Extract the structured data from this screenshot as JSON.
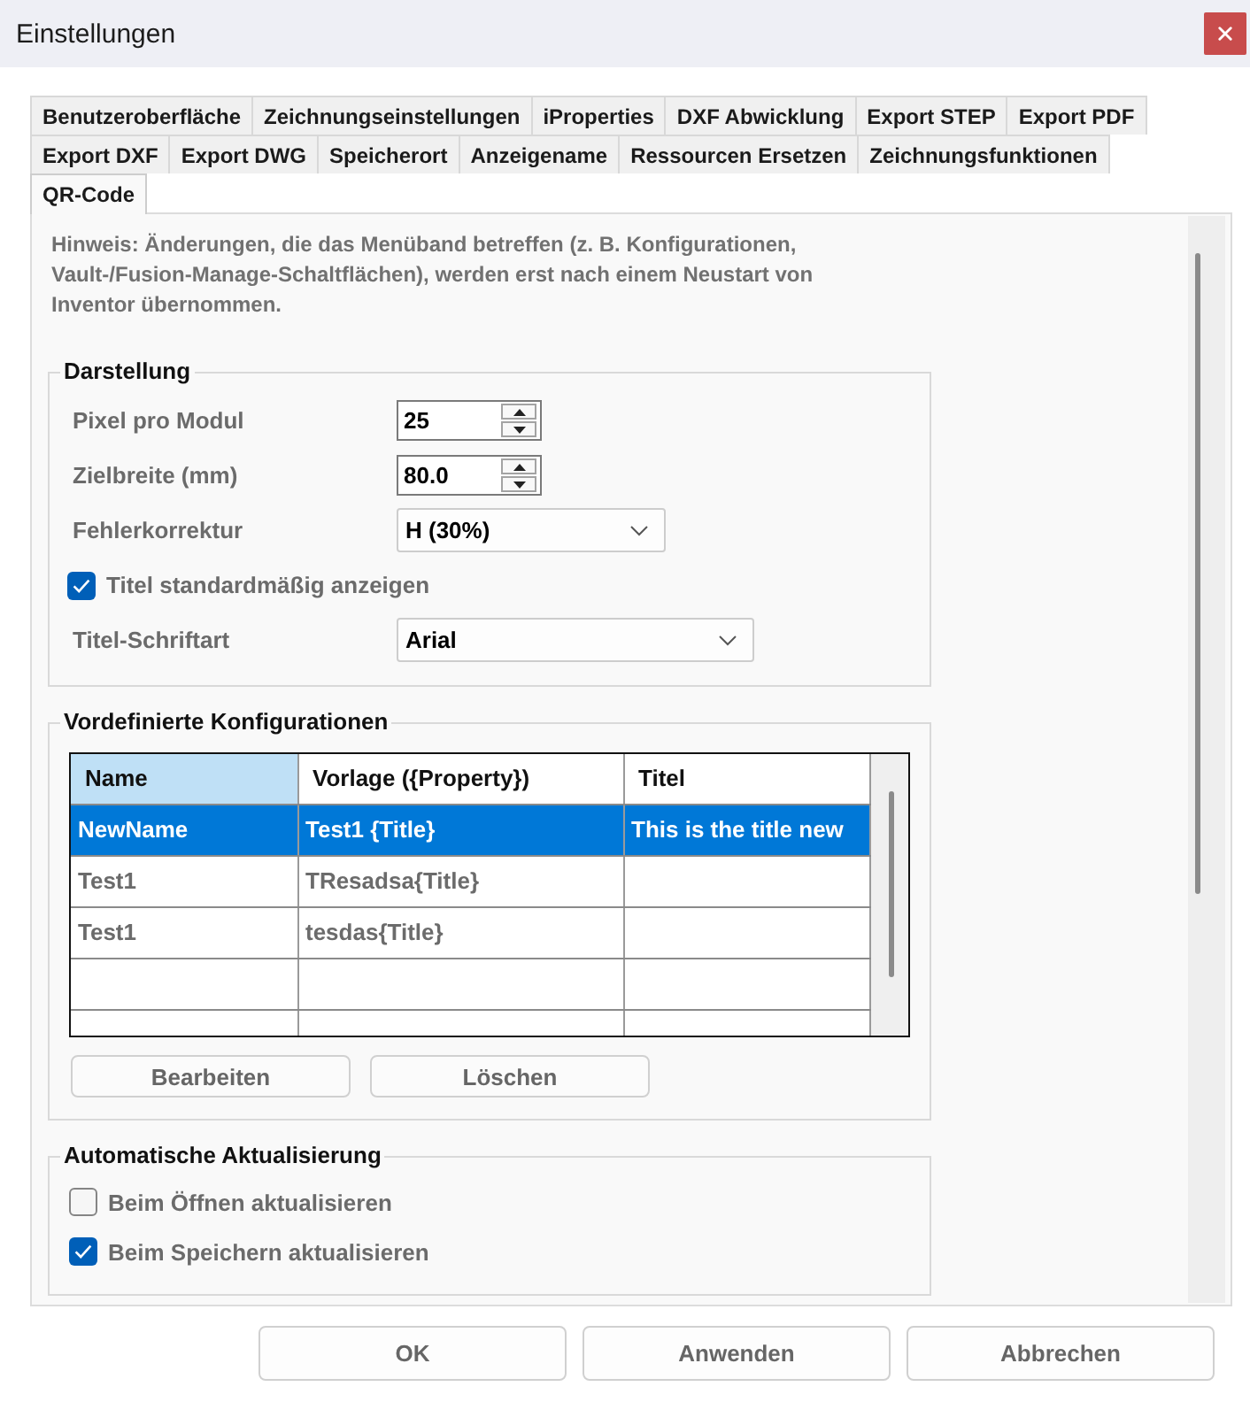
{
  "window": {
    "title": "Einstellungen"
  },
  "tab_rows": [
    {
      "tabs": [
        {
          "label": "Benutzeroberfläche",
          "selected": false
        },
        {
          "label": "Zeichnungseinstellungen",
          "selected": false
        },
        {
          "label": "iProperties",
          "selected": false
        },
        {
          "label": "DXF Abwicklung",
          "selected": false
        },
        {
          "label": "Export STEP",
          "selected": false
        },
        {
          "label": "Export PDF",
          "selected": false
        }
      ]
    },
    {
      "tabs": [
        {
          "label": "Export DXF",
          "selected": false
        },
        {
          "label": "Export DWG",
          "selected": false
        },
        {
          "label": "Speicherort",
          "selected": false
        },
        {
          "label": "Anzeigename",
          "selected": false
        },
        {
          "label": "Ressourcen Ersetzen",
          "selected": false
        },
        {
          "label": "Zeichnungsfunktionen",
          "selected": false
        }
      ]
    },
    {
      "tabs": [
        {
          "label": "QR-Code",
          "selected": true
        }
      ]
    }
  ],
  "hint": "Hinweis: Änderungen, die das Menüband betreffen (z. B. Konfigurationen, Vault-/Fusion-Manage-Schaltflächen), werden erst nach einem Neustart von Inventor übernommen.",
  "display": {
    "title": "Darstellung",
    "fields": [
      {
        "kind": "spinner",
        "label": "Pixel pro Modul",
        "value": "25"
      },
      {
        "kind": "spinner",
        "label": "Zielbreite (mm)",
        "value": "80.0"
      },
      {
        "kind": "dropdown",
        "label": "Fehlerkorrektur",
        "value": "H (30%)"
      },
      {
        "kind": "checkbox",
        "label": "Titel standardmäßig anzeigen",
        "checked": true
      },
      {
        "kind": "dropdown",
        "label": "Titel-Schriftart",
        "value": "Arial"
      }
    ]
  },
  "configurations": {
    "title": "Vordefinierte Konfigurationen",
    "table": {
      "columns": [
        {
          "label": "Name",
          "selected": true
        },
        {
          "label": "Vorlage ({Property})",
          "selected": false
        },
        {
          "label": "Titel",
          "selected": false
        }
      ],
      "rows": [
        {
          "cells": [
            "NewName",
            "Test1 {Title}",
            "This is the title new"
          ],
          "selected": true
        },
        {
          "cells": [
            "Test1",
            "TResadsa{Title}"
          ],
          "selected": false
        },
        {
          "cells": [
            "Test1",
            "tesdas{Title}"
          ],
          "selected": false
        }
      ]
    },
    "buttons": [
      "Bearbeiten",
      "Löschen"
    ]
  },
  "auto_update": {
    "title": "Automatische Aktualisierung",
    "options": [
      {
        "label": "Beim Öffnen aktualisieren",
        "checked": false
      },
      {
        "label": "Beim Speichern aktualisieren",
        "checked": true
      }
    ]
  },
  "dialog_buttons": [
    "OK",
    "Anwenden",
    "Abbrechen"
  ]
}
